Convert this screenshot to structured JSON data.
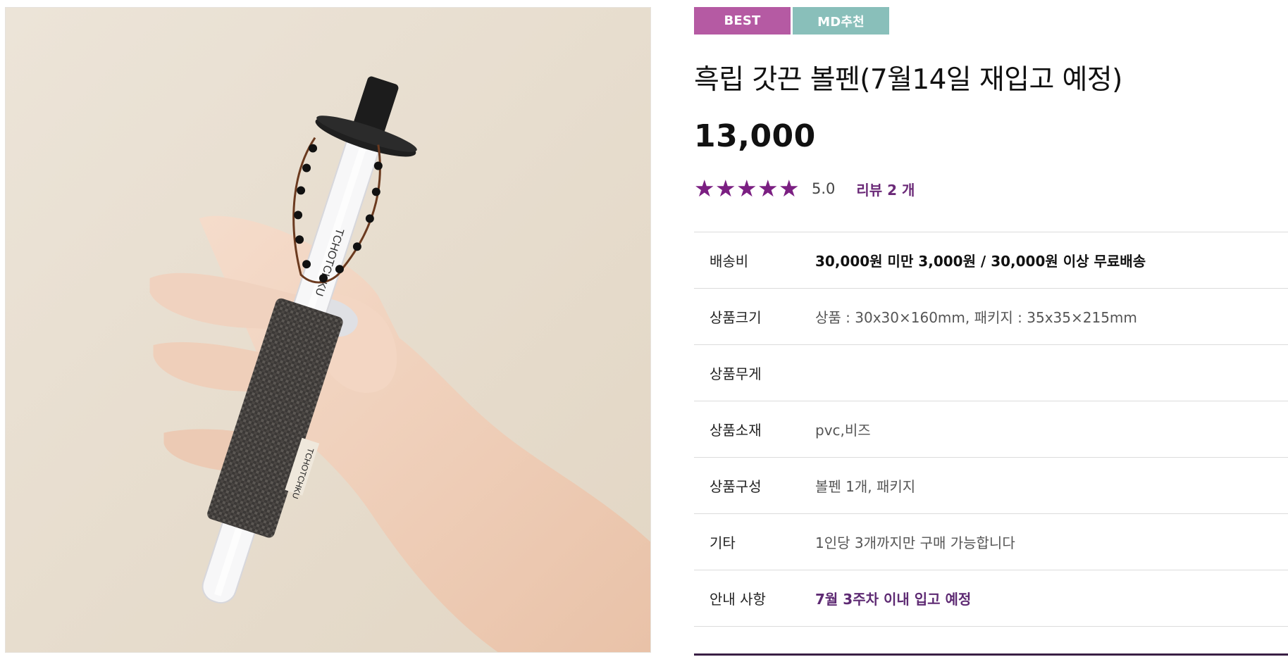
{
  "badges": {
    "best": "BEST",
    "md": "MD추천"
  },
  "product": {
    "title": "흑립 갓끈 볼펜(7월14일 재입고 예정)",
    "price": "13,000",
    "rating_score": "5.0",
    "rating_stars": 5,
    "review_link": "리뷰 2 개"
  },
  "image": {
    "pen_label_top": "TCHOTCHKU",
    "pen_label_tag": "TCHOTCHKU"
  },
  "specs": [
    {
      "label": "배송비",
      "value": "30,000원 미만 3,000원 / 30,000원 이상 무료배송"
    },
    {
      "label": "상품크기",
      "value": "상품 : 30x30×160mm, 패키지 : 35x35×215mm"
    },
    {
      "label": "상품무게",
      "value": ""
    },
    {
      "label": "상품소재",
      "value": "pvc,비즈"
    },
    {
      "label": "상품구성",
      "value": "볼펜 1개, 패키지"
    },
    {
      "label": "기타",
      "value": "1인당 3개까지만 구매 가능합니다"
    },
    {
      "label": "안내 사항",
      "value": "7월 3주차 이내 입고 예정"
    }
  ],
  "colors": {
    "badge_best": "#b55aa3",
    "badge_md": "#89bfba",
    "star": "#7b1f82",
    "accent_text": "#5e2a73"
  }
}
